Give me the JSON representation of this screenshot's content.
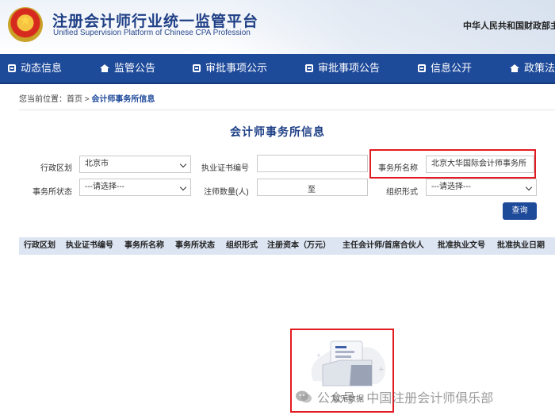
{
  "header": {
    "title": "注册会计师行业统一监管平台",
    "subtitle": "Unified Supervision Platform of Chinese CPA Profession",
    "ministry": "中华人民共和国财政部主"
  },
  "nav": {
    "items": [
      {
        "label": "动态信息",
        "icon": "document-icon"
      },
      {
        "label": "监管公告",
        "icon": "house-icon"
      },
      {
        "label": "审批事项公示",
        "icon": "monitor-icon"
      },
      {
        "label": "审批事项公告",
        "icon": "chat-icon"
      },
      {
        "label": "信息公开",
        "icon": "grid-icon"
      },
      {
        "label": "政策法",
        "icon": "bank-icon"
      }
    ]
  },
  "breadcrumb": {
    "prefix": "您当前位置：首页 >",
    "current": "会计师事务所信息"
  },
  "form": {
    "title": "会计师事务所信息",
    "region_label": "行政区划",
    "region_value": "北京市",
    "cert_label": "执业证书编号",
    "cert_value": "",
    "name_label": "事务所名称",
    "name_value": "北京大华国际会计师事务所",
    "status_label": "事务所状态",
    "status_value": "---请选择---",
    "count_label": "注师数量(人)",
    "count_separator": "至",
    "org_label": "组织形式",
    "org_value": "---请选择---",
    "query_label": "查询"
  },
  "table": {
    "headers": [
      "行政区划",
      "执业证书编号",
      "事务所名称",
      "事务所状态",
      "组织形式",
      "注册资本（万元）",
      "主任会计师/首席合伙人",
      "批准执业文号",
      "批准执业日期"
    ]
  },
  "empty_state": {
    "text": "暂无数据"
  },
  "watermark": {
    "text": "公众号 · 中国注册会计师俱乐部"
  },
  "colors": {
    "nav_bg": "#1e4a9a",
    "title_blue": "#1e3f86",
    "highlight_red": "#e11b22",
    "table_header_bg": "#dde5f2"
  }
}
